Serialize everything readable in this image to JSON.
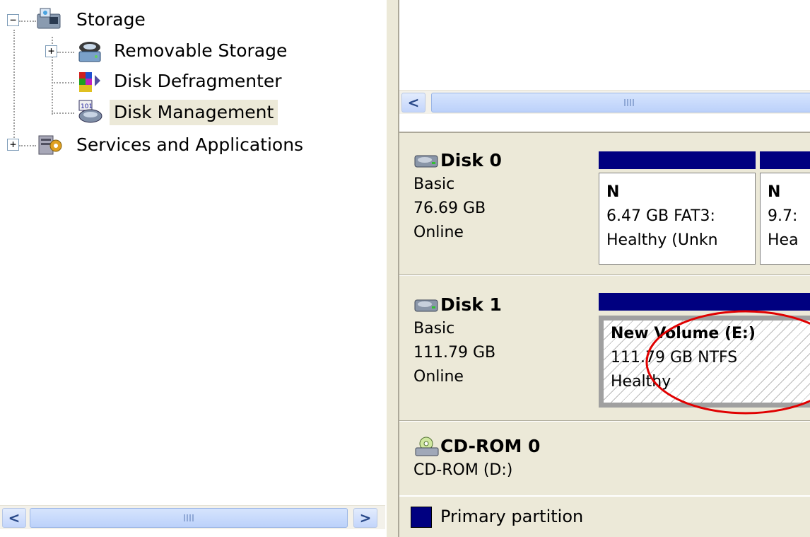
{
  "tree": {
    "items": [
      {
        "label": "Storage",
        "expander": "−"
      },
      {
        "label": "Removable Storage",
        "expander": "+"
      },
      {
        "label": "Disk Defragmenter"
      },
      {
        "label": "Disk Management"
      },
      {
        "label": "Services and Applications",
        "expander": "+"
      }
    ]
  },
  "scroll": {
    "left_arrow": "<",
    "right_arrow": ">"
  },
  "disks": [
    {
      "title": "Disk 0",
      "type": "Basic",
      "size": "76.69 GB",
      "status": "Online",
      "volumes": [
        {
          "name": "N",
          "size": "6.47 GB FAT3:",
          "status": "Healthy (Unkn"
        },
        {
          "name": "N",
          "size": "9.7:",
          "status": "Hea"
        }
      ]
    },
    {
      "title": "Disk 1",
      "type": "Basic",
      "size": "111.79 GB",
      "status": "Online",
      "volumes": [
        {
          "name": "New Volume  (E:)",
          "size": "111.79 GB NTFS",
          "status": "Healthy"
        }
      ]
    },
    {
      "title": "CD-ROM 0",
      "type": "CD-ROM (D:)"
    }
  ],
  "legend": {
    "primary_label": "Primary partition",
    "primary_color": "#000080"
  },
  "colors": {
    "selection": "#ece9d8",
    "partition_bar": "#000080",
    "annotation": "#e00000"
  }
}
